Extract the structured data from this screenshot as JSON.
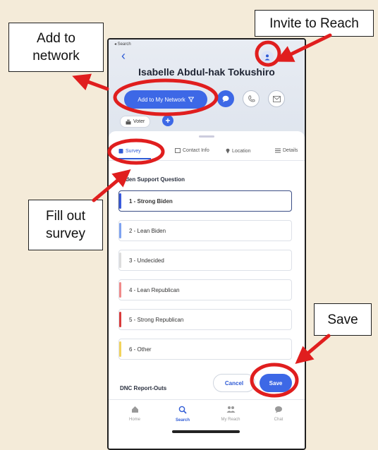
{
  "status_bar": {
    "text": "◂ Search"
  },
  "header": {
    "back_icon": "chevron-left-icon",
    "invite_icon": "person-plus-icon",
    "contact_name": "Isabelle Abdul-hak Tokushiro"
  },
  "actions": {
    "add_to_network_label": "Add to My Network",
    "chat_icon": "chat-icon",
    "phone_icon": "phone-icon",
    "email_icon": "mail-icon"
  },
  "badge": {
    "voter_label": "Voter",
    "add_symbol": "+"
  },
  "tabs": [
    {
      "label": "Survey",
      "icon": "clipboard-icon"
    },
    {
      "label": "Contact Info",
      "icon": "id-card-icon"
    },
    {
      "label": "Location",
      "icon": "pin-icon"
    },
    {
      "label": "Details",
      "icon": "list-icon"
    }
  ],
  "survey": {
    "question": "Biden Support Question",
    "selected_index": 0,
    "options": [
      {
        "label": "1 - Strong Biden",
        "color": "#3b5bdb"
      },
      {
        "label": "2 - Lean Biden",
        "color": "#7fa3f0"
      },
      {
        "label": "3 - Undecided",
        "color": "#dddddd"
      },
      {
        "label": "4 - Lean Republican",
        "color": "#f08a8a"
      },
      {
        "label": "5 - Strong Republican",
        "color": "#d93b3b"
      },
      {
        "label": "6 - Other",
        "color": "#f2d35c"
      }
    ],
    "next_section": "DNC Report-Outs"
  },
  "footer_buttons": {
    "cancel_label": "Cancel",
    "save_label": "Save"
  },
  "bottom_nav": [
    {
      "label": "Home",
      "icon": "home-icon"
    },
    {
      "label": "Search",
      "icon": "search-icon"
    },
    {
      "label": "My Reach",
      "icon": "people-icon"
    },
    {
      "label": "Chat",
      "icon": "chat-bubble-icon"
    }
  ],
  "callouts": {
    "invite": "Invite to Reach",
    "add_to_network": "Add to\nnetwork",
    "fill_survey": "Fill out\nsurvey",
    "save": "Save"
  },
  "annotation_color": "#e01e1e"
}
